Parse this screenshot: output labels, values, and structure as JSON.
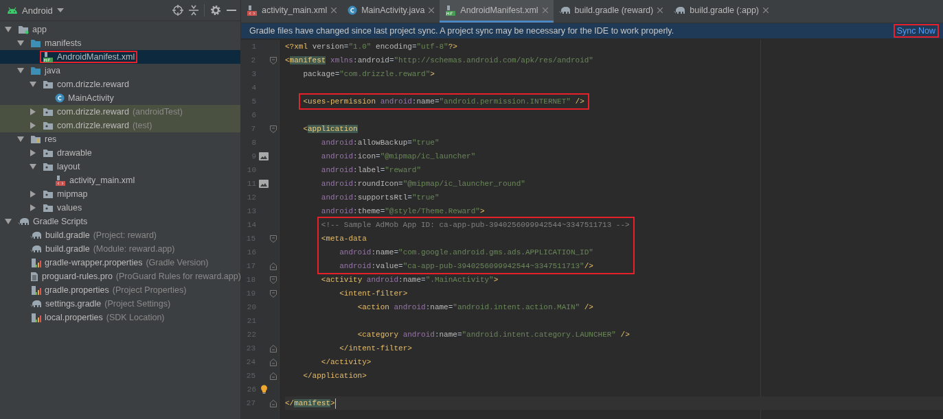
{
  "project_panel": {
    "view": "Android",
    "tree": [
      {
        "label": "app",
        "kind": "module",
        "expanded": true,
        "selected": false,
        "boxed": false,
        "children": [
          {
            "label": "manifests",
            "kind": "folder",
            "expanded": true,
            "selected": false,
            "boxed": false,
            "children": [
              {
                "label": "AndroidManifest.xml",
                "kind": "manifest",
                "selected": true,
                "boxed": true
              }
            ]
          },
          {
            "label": "java",
            "kind": "folder",
            "expanded": true,
            "selected": false,
            "boxed": false,
            "children": [
              {
                "label": "com.drizzle.reward",
                "kind": "package",
                "expanded": true,
                "selected": false,
                "boxed": false,
                "tinted": false,
                "children": [
                  {
                    "label": "MainActivity",
                    "kind": "class",
                    "selected": false,
                    "boxed": false
                  }
                ]
              },
              {
                "label": "com.drizzle.reward",
                "note": "(androidTest)",
                "kind": "package",
                "expanded": false,
                "selected": false,
                "boxed": false,
                "tinted": true
              },
              {
                "label": "com.drizzle.reward",
                "note": "(test)",
                "kind": "package",
                "expanded": false,
                "selected": false,
                "boxed": false,
                "tinted": true
              }
            ]
          },
          {
            "label": "res",
            "kind": "res",
            "expanded": true,
            "selected": false,
            "boxed": false,
            "children": [
              {
                "label": "drawable",
                "kind": "package",
                "expanded": false,
                "selected": false,
                "boxed": false
              },
              {
                "label": "layout",
                "kind": "package",
                "expanded": true,
                "selected": false,
                "boxed": false,
                "children": [
                  {
                    "label": "activity_main.xml",
                    "kind": "layout",
                    "selected": false,
                    "boxed": false
                  }
                ]
              },
              {
                "label": "mipmap",
                "kind": "package",
                "expanded": false,
                "selected": false,
                "boxed": false
              },
              {
                "label": "values",
                "kind": "package",
                "expanded": false,
                "selected": false,
                "boxed": false
              }
            ]
          }
        ]
      },
      {
        "label": "Gradle Scripts",
        "kind": "gradle",
        "expanded": true,
        "selected": false,
        "boxed": false,
        "children": [
          {
            "label": "build.gradle",
            "note": "(Project: reward)",
            "kind": "gradle",
            "selected": false,
            "boxed": false
          },
          {
            "label": "build.gradle",
            "note": "(Module: reward.app)",
            "kind": "gradle",
            "selected": false,
            "boxed": false
          },
          {
            "label": "gradle-wrapper.properties",
            "note": "(Gradle Version)",
            "kind": "properties",
            "selected": false,
            "boxed": false
          },
          {
            "label": "proguard-rules.pro",
            "note": "(ProGuard Rules for reward.app)",
            "kind": "text",
            "selected": false,
            "boxed": false
          },
          {
            "label": "gradle.properties",
            "note": "(Project Properties)",
            "kind": "properties",
            "selected": false,
            "boxed": false
          },
          {
            "label": "settings.gradle",
            "note": "(Project Settings)",
            "kind": "gradle",
            "selected": false,
            "boxed": false
          },
          {
            "label": "local.properties",
            "note": "(SDK Location)",
            "kind": "properties",
            "selected": false,
            "boxed": false
          }
        ]
      }
    ]
  },
  "tabs": [
    {
      "label": "activity_main.xml",
      "kind": "layout",
      "selected": false
    },
    {
      "label": "MainActivity.java",
      "kind": "class",
      "selected": false
    },
    {
      "label": "AndroidManifest.xml",
      "kind": "manifest",
      "selected": true
    },
    {
      "label": "build.gradle (reward)",
      "kind": "gradle",
      "selected": false
    },
    {
      "label": "build.gradle (:app)",
      "kind": "gradle",
      "selected": false
    }
  ],
  "notification": {
    "message": "Gradle files have changed since last project sync. A project sync may be necessary for the IDE to work properly.",
    "action": "Sync Now",
    "boxed": true
  },
  "editor": {
    "lines": [
      {
        "number": "1",
        "kind": "plain",
        "current": false,
        "boxed": false,
        "tag_highlighted": false,
        "text": "<?xml version=\"1.0\" encoding=\"utf-8\"?>"
      },
      {
        "number": "2",
        "kind": "fold-start",
        "current": false,
        "boxed": false,
        "tag_highlighted": true,
        "text": "<manifest xmlns:android=\"http://schemas.android.com/apk/res/android\""
      },
      {
        "number": "3",
        "kind": "plain",
        "current": false,
        "boxed": false,
        "text": "    package=\"com.drizzle.reward\">"
      },
      {
        "number": "4",
        "kind": "plain"
      },
      {
        "number": "5",
        "kind": "plain",
        "current": false,
        "boxed": true,
        "tag_highlighted": false,
        "text": "    <uses-permission android:name=\"android.permission.INTERNET\" />"
      },
      {
        "number": "6",
        "kind": "plain"
      },
      {
        "number": "7",
        "kind": "fold-start",
        "current": false,
        "boxed": false,
        "tag_highlighted": true,
        "text": "    <application"
      },
      {
        "number": "8",
        "kind": "plain",
        "current": false,
        "boxed": false,
        "text": "        android:allowBackup=\"true\""
      },
      {
        "number": "9",
        "kind": "image",
        "current": false,
        "boxed": false,
        "text": "        android:icon=\"@mipmap/ic_launcher\""
      },
      {
        "number": "10",
        "kind": "plain",
        "current": false,
        "boxed": false,
        "text": "        android:label=\"reward\""
      },
      {
        "number": "11",
        "kind": "image",
        "current": false,
        "boxed": false,
        "text": "        android:roundIcon=\"@mipmap/ic_launcher_round\""
      },
      {
        "number": "12",
        "kind": "plain",
        "current": false,
        "boxed": false,
        "text": "        android:supportsRtl=\"true\""
      },
      {
        "number": "13",
        "kind": "plain",
        "current": false,
        "boxed": false,
        "text": "        android:theme=\"@style/Theme.Reward\">"
      },
      {
        "number": "14",
        "kind": "plain",
        "current": false,
        "boxed": true,
        "text": "        <!-- Sample AdMob App ID: ca-app-pub-3940256099942544~3347511713 -->"
      },
      {
        "number": "15",
        "kind": "fold-start",
        "current": false,
        "boxed": true,
        "tag_highlighted": false,
        "text": "        <meta-data"
      },
      {
        "number": "16",
        "kind": "plain",
        "current": false,
        "boxed": true,
        "text": "            android:name=\"com.google.android.gms.ads.APPLICATION_ID\""
      },
      {
        "number": "17",
        "kind": "fold-end",
        "current": false,
        "boxed": true,
        "text": "            android:value=\"ca-app-pub-3940256099942544~3347511713\"/>"
      },
      {
        "number": "18",
        "kind": "fold-start",
        "current": false,
        "boxed": false,
        "tag_highlighted": false,
        "text": "        <activity android:name=\".MainActivity\">"
      },
      {
        "number": "19",
        "kind": "fold-start",
        "current": false,
        "boxed": false,
        "tag_highlighted": false,
        "text": "            <intent-filter>"
      },
      {
        "number": "20",
        "kind": "plain",
        "current": false,
        "boxed": false,
        "tag_highlighted": false,
        "text": "                <action android:name=\"android.intent.action.MAIN\" />"
      },
      {
        "number": "21",
        "kind": "plain"
      },
      {
        "number": "22",
        "kind": "plain",
        "current": false,
        "boxed": false,
        "tag_highlighted": false,
        "text": "                <category android:name=\"android.intent.category.LAUNCHER\" />"
      },
      {
        "number": "23",
        "kind": "fold-end",
        "current": false,
        "boxed": false,
        "tag_highlighted": false,
        "text": "            </intent-filter>"
      },
      {
        "number": "24",
        "kind": "fold-end",
        "current": false,
        "boxed": false,
        "tag_highlighted": false,
        "text": "        </activity>"
      },
      {
        "number": "25",
        "kind": "fold-end",
        "current": false,
        "boxed": false,
        "tag_highlighted": false,
        "text": "    </application>"
      },
      {
        "number": "26",
        "kind": "bulb"
      },
      {
        "number": "27",
        "kind": "fold-end",
        "current": true,
        "boxed": false,
        "tag_highlighted": true,
        "text": "</manifest>"
      }
    ]
  }
}
